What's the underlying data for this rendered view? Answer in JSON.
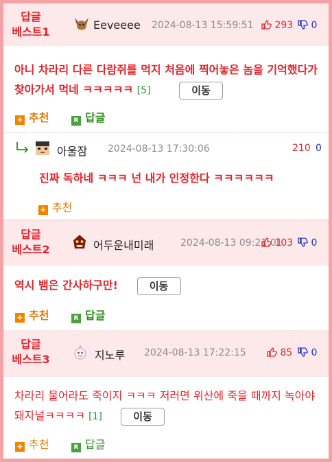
{
  "comments": [
    {
      "badge": [
        "답글",
        "베스트1"
      ],
      "user": "Eeveeee",
      "avatar": "eevee-avatar",
      "date": "2024-08-13 15:59:51",
      "up": "293",
      "down": "0",
      "text": "아니 차라리 다른 다람쥐를 먹지 처음에 찍어놓은 놈을 기억했다가 찾아가서 먹네 ㅋㅋㅋㅋㅋ",
      "count": "[5]",
      "move_label": "이동",
      "recommend_label": "추천",
      "reply_label": "답글",
      "reply": {
        "user": "아울잠",
        "date": "2024-08-13 17:30:06",
        "up": "210",
        "down": "0",
        "text": "진짜 독하네 ㅋㅋㅋ 넌 내가 인정한다 ㅋㅋㅋㅋㅋㅋ",
        "recommend_label": "추천"
      }
    },
    {
      "badge": [
        "답글",
        "베스트2"
      ],
      "user": "어두운내미래",
      "date": "2024-08-13 09:21:01",
      "up": "103",
      "down": "0",
      "text": "역시 뱀은 간사하구만!",
      "move_label": "이동",
      "recommend_label": "추천",
      "reply_label": "답글"
    },
    {
      "badge": [
        "답글",
        "베스트3"
      ],
      "user": "지노루",
      "date": "2024-08-13 17:22:15",
      "up": "85",
      "down": "0",
      "text": "차라리 물어라도 죽이지 ㅋㅋㅋ 저러면 위산에 죽을 때까지 녹아야돼자널ㅋㅋㅋㅋ",
      "count": "[1]",
      "move_label": "이동",
      "recommend_label": "추천",
      "reply_label": "답글"
    }
  ],
  "colors": {
    "badge": "#e3242b",
    "header_bg": "#fde9ea",
    "frame": "#f3a3a6",
    "up": "#e3242b",
    "down": "#1a2fd1",
    "recommend": "#e07b00",
    "reply": "#2f8f1e"
  }
}
